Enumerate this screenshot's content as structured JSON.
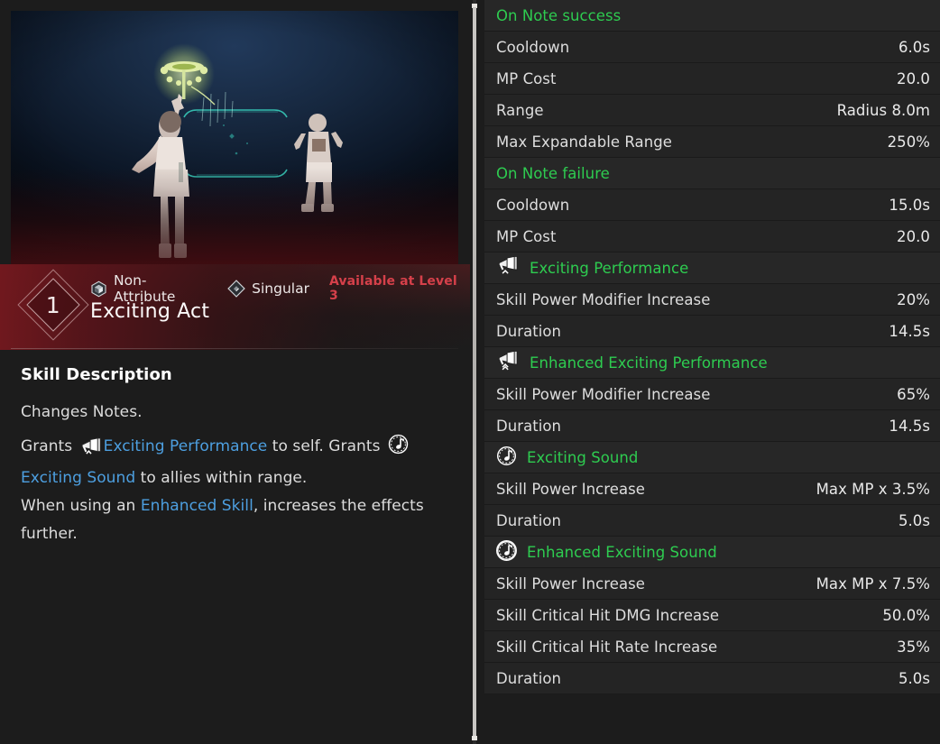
{
  "skill": {
    "level": "1",
    "name": "Exciting Act",
    "attribute_label": "Non-Attribute",
    "attribute_icon": "hex-cube-icon",
    "type_label": "Singular",
    "type_icon": "diamond-stack-icon",
    "availability": "Available at Level 3",
    "availability_color": "#d5404a"
  },
  "description": {
    "heading": "Skill Description",
    "notes": "Changes Notes.",
    "line1_pre": "Grants",
    "line1_kw1": "Exciting Performance",
    "line1_mid": "to self. Grants",
    "line1_kw2": "Exciting Sound",
    "line1_post": "to allies within range.",
    "line2_pre": "When using an",
    "line2_kw": "Enhanced Skill",
    "line2_post": ", increases the effects further.",
    "keyword_color": "#4d9fe0"
  },
  "preview": {
    "name": "skill-preview-video",
    "caster_label": "caster-character",
    "ally_label": "ally-character"
  },
  "stats": {
    "group_color": "#2ecc50",
    "rows": [
      {
        "kind": "group",
        "label": "On Note success",
        "icon": "",
        "value": ""
      },
      {
        "kind": "stat",
        "label": "Cooldown",
        "value": "6.0s"
      },
      {
        "kind": "stat",
        "label": "MP Cost",
        "value": "20.0"
      },
      {
        "kind": "stat",
        "label": "Range",
        "value": "Radius 8.0m"
      },
      {
        "kind": "stat",
        "label": "Max Expandable Range",
        "value": "250%"
      },
      {
        "kind": "group",
        "label": "On Note failure",
        "icon": "",
        "value": ""
      },
      {
        "kind": "stat",
        "label": "Cooldown",
        "value": "15.0s"
      },
      {
        "kind": "stat",
        "label": "MP Cost",
        "value": "20.0"
      },
      {
        "kind": "group",
        "label": "Exciting Performance",
        "icon": "megaphone-icon",
        "value": ""
      },
      {
        "kind": "stat",
        "label": "Skill Power Modifier Increase",
        "value": "20%"
      },
      {
        "kind": "stat",
        "label": "Duration",
        "value": "14.5s"
      },
      {
        "kind": "group",
        "label": "Enhanced Exciting Performance",
        "icon": "megaphone-enhanced-icon",
        "value": ""
      },
      {
        "kind": "stat",
        "label": "Skill Power Modifier Increase",
        "value": "65%"
      },
      {
        "kind": "stat",
        "label": "Duration",
        "value": "14.5s"
      },
      {
        "kind": "group",
        "label": "Exciting Sound",
        "icon": "music-note-icon",
        "value": ""
      },
      {
        "kind": "stat",
        "label": "Skill Power Increase",
        "value": "Max MP x 3.5%"
      },
      {
        "kind": "stat",
        "label": "Duration",
        "value": "5.0s"
      },
      {
        "kind": "group",
        "label": "Enhanced Exciting Sound",
        "icon": "music-note-enhanced-icon",
        "value": ""
      },
      {
        "kind": "stat",
        "label": "Skill Power Increase",
        "value": "Max MP x 7.5%"
      },
      {
        "kind": "stat",
        "label": "Skill Critical Hit DMG Increase",
        "value": "50.0%"
      },
      {
        "kind": "stat",
        "label": "Skill Critical Hit Rate Increase",
        "value": "35%"
      },
      {
        "kind": "stat",
        "label": "Duration",
        "value": "5.0s"
      }
    ]
  }
}
